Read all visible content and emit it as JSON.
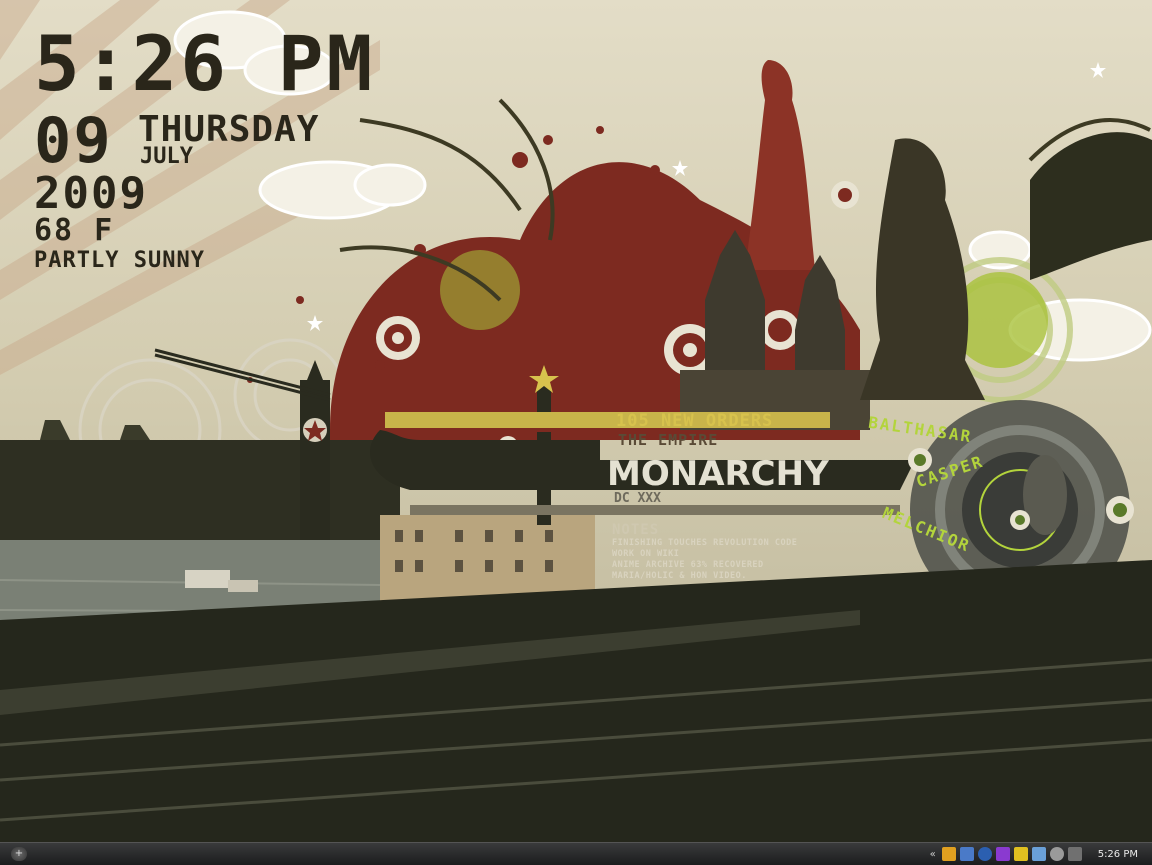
{
  "clock": {
    "time": "5:26 PM",
    "day": "09",
    "weekday": "THURSDAY",
    "month": "JULY",
    "year": "2009",
    "temperature": "68 F",
    "condition": "PARTLY SUNNY"
  },
  "banner": {
    "orders": "105 NEW ORDERS",
    "empire": "THE EMPIRE",
    "title": "MONARCHY",
    "subtitle": "DC XXX"
  },
  "notes": {
    "title": "NOTES",
    "items": [
      "FINISHING TOUCHES REVOLUTION CODE",
      "WORK ON WIKI",
      "ANIME ARCHIVE 63% RECOVERED",
      "MARIA/HOLIC & HON VIDEO."
    ]
  },
  "ring_labels": [
    "BALTHASAR",
    "CASPER",
    "MELCHIOR"
  ],
  "taskbar": {
    "start_glyph": "+",
    "tray_chevron": "«",
    "time": "5:26 PM",
    "tray_icons": [
      "lightning-icon",
      "monitor-icon",
      "drop-icon",
      "sync-icon",
      "shield-icon",
      "network-icon",
      "volume-icon",
      "usb-icon"
    ]
  },
  "colors": {
    "accent_green": "#b3d43c",
    "accent_red": "#7d2a20",
    "sky": "#d9d3b8",
    "ink": "#2a261a",
    "taskbar": "#2a2b2c"
  }
}
